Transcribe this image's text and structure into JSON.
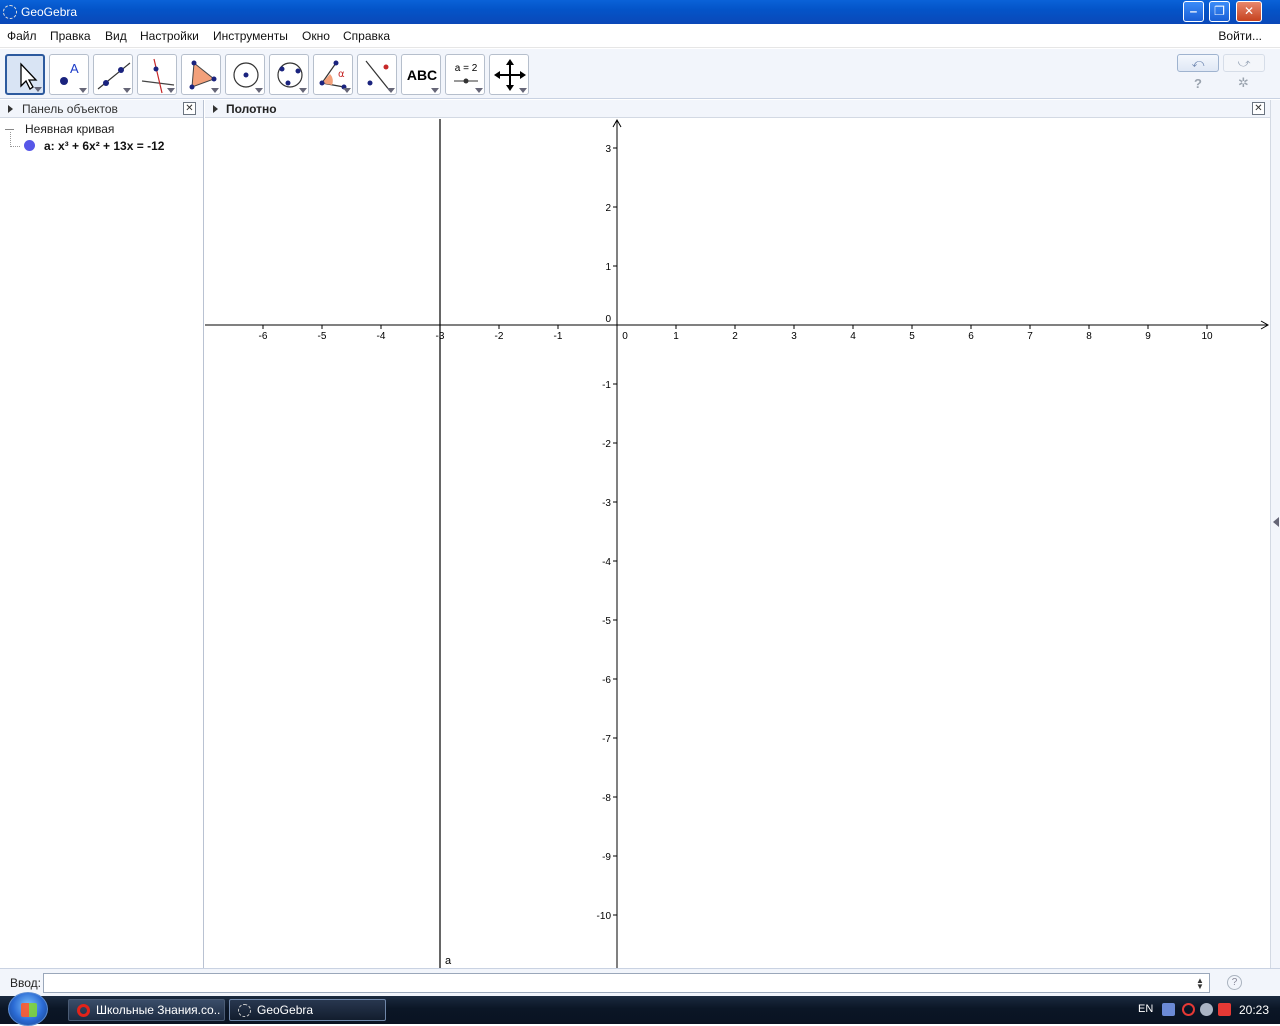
{
  "window": {
    "title": "GeoGebra",
    "controls": [
      "minimize-icon",
      "restore-icon",
      "close-icon"
    ]
  },
  "menu": {
    "items": [
      "Файл",
      "Правка",
      "Вид",
      "Настройки",
      "Инструменты",
      "Окно",
      "Справка"
    ],
    "login": "Войти..."
  },
  "toolbar": {
    "tools": [
      {
        "icon": "move-arrow-icon",
        "selected": true
      },
      {
        "icon": "point-icon"
      },
      {
        "icon": "line-icon"
      },
      {
        "icon": "perpendicular-line-icon"
      },
      {
        "icon": "polygon-icon"
      },
      {
        "icon": "circle-center-point-icon"
      },
      {
        "icon": "circle-three-points-icon"
      },
      {
        "icon": "angle-icon"
      },
      {
        "icon": "reflect-icon"
      },
      {
        "icon": "text-icon",
        "label": "ABC"
      },
      {
        "icon": "slider-icon",
        "label": "a = 2"
      },
      {
        "icon": "move-graphics-view-icon"
      }
    ],
    "undo_icon": "undo-icon",
    "redo_icon": "redo-icon",
    "help_label": "?",
    "settings_icon": "gear-icon"
  },
  "algebra_panel": {
    "title": "Панель объектов",
    "category": "Неявная кривая",
    "objects": [
      {
        "label": "a: x³ + 6x² + 13x = -12",
        "color": "#5757e8"
      }
    ]
  },
  "graphics_panel": {
    "title": "Полотно",
    "x_ticks": [
      "-6",
      "-5",
      "-4",
      "-3",
      "-2",
      "-1",
      "0",
      "1",
      "2",
      "3",
      "4",
      "5",
      "6",
      "7",
      "8",
      "9",
      "10"
    ],
    "y_ticks": [
      "3",
      "2",
      "1",
      "-1",
      "-2",
      "-3",
      "-4",
      "-5",
      "-6",
      "-7",
      "-8",
      "-9",
      "-10"
    ],
    "curve": {
      "name": "a",
      "x": -3
    }
  },
  "input_bar": {
    "label": "Ввод:",
    "value": "",
    "help": "?"
  },
  "taskbar": {
    "tasks": [
      {
        "label": "Школьные Знания.co...",
        "icon": "opera-icon",
        "active": false
      },
      {
        "label": "GeoGebra",
        "icon": "geogebra-icon",
        "active": true
      }
    ],
    "language": "EN",
    "clock": "20:23"
  }
}
